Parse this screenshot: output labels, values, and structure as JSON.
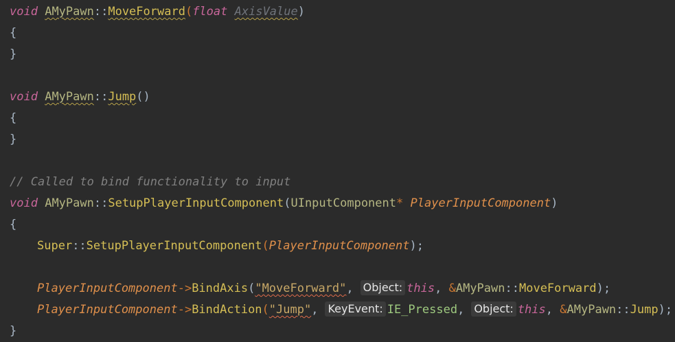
{
  "code": {
    "l1": {
      "kw": "void",
      "cls": "AMyPawn",
      "sep": "::",
      "fn": "MoveForward",
      "lp": "(",
      "type": "float",
      "param": "AxisValue",
      "rp": ")"
    },
    "l2": {
      "brace": "{"
    },
    "l3": {
      "brace": "}"
    },
    "l5": {
      "kw": "void",
      "cls": "AMyPawn",
      "sep": "::",
      "fn": "Jump",
      "parens": "()"
    },
    "l6": {
      "brace": "{"
    },
    "l7": {
      "brace": "}"
    },
    "l9": {
      "comment": "// Called to bind functionality to input"
    },
    "l10": {
      "kw": "void",
      "cls": "AMyPawn",
      "sep": "::",
      "fn": "SetupPlayerInputComponent",
      "lp": "(",
      "type": "UInputComponent",
      "ptr": "*",
      "param": "PlayerInputComponent",
      "rp": ")"
    },
    "l11": {
      "brace": "{"
    },
    "l12": {
      "ns": "Super",
      "sep": "::",
      "fn": "SetupPlayerInputComponent",
      "lp": "(",
      "param": "PlayerInputComponent",
      "rp": ");"
    },
    "l14": {
      "param": "PlayerInputComponent",
      "arrow": "->",
      "fn": "BindAxis",
      "lp": "(",
      "str": "\"MoveForward\"",
      "comma1": ",",
      "hint_object": "Object:",
      "this": "this",
      "comma2": ",",
      "amp": "&",
      "cls": "AMyPawn",
      "sep": "::",
      "fnref": "MoveForward",
      "rp": ");"
    },
    "l15": {
      "param": "PlayerInputComponent",
      "arrow": "->",
      "fn": "BindAction",
      "lp": "(",
      "str": "\"Jump\"",
      "comma1": ",",
      "hint_keyevent": "KeyEvent:",
      "enum": "IE_Pressed",
      "comma2": ",",
      "hint_object": "Object:",
      "this": "this",
      "comma3": ",",
      "amp": "&",
      "cls": "AMyPawn",
      "sep": "::",
      "fnref": "Jump",
      "rp": ");"
    },
    "l16": {
      "brace": "}"
    }
  }
}
